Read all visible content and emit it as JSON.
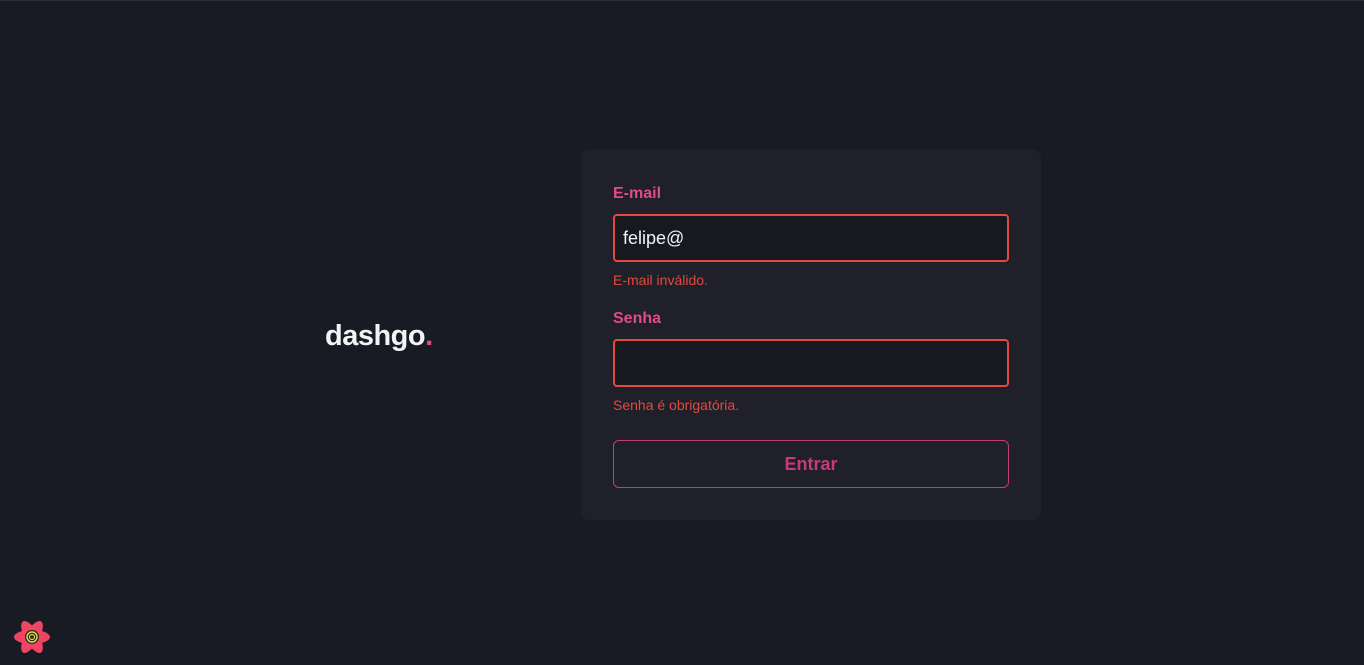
{
  "logo": {
    "text": "dashgo",
    "dot": "."
  },
  "form": {
    "email": {
      "label": "E-mail",
      "value": "felipe@",
      "error": "E-mail inválido."
    },
    "password": {
      "label": "Senha",
      "value": "",
      "error": "Senha é obrigatória."
    },
    "submit_label": "Entrar"
  },
  "devtools": {
    "icon": "react-query-devtools-icon"
  },
  "colors": {
    "background": "#181b23",
    "card": "#1f2029",
    "accent": "#e14b88",
    "error": "#e5483e",
    "button": "#c43c7d"
  }
}
